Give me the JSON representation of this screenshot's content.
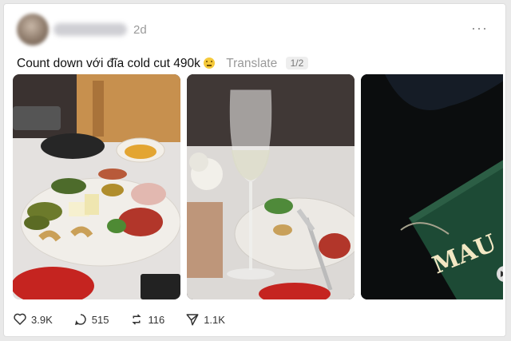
{
  "post": {
    "time": "2d",
    "more_label": "···",
    "caption": "Count down với đĩa cold cut 490k",
    "translate_label": "Translate",
    "page_indicator": "1/2"
  },
  "photos": [
    {
      "alt": "cold cut plate"
    },
    {
      "alt": "wine glass"
    },
    {
      "alt": "MAU sign",
      "sign_text": "MAU"
    }
  ],
  "stats": {
    "likes": "3.9K",
    "replies": "515",
    "reposts": "116",
    "shares": "1.1K"
  }
}
